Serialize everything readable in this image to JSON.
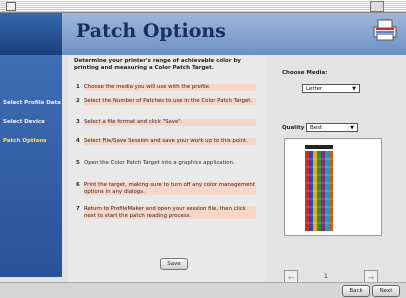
{
  "header": {
    "title": "Patch Options"
  },
  "sidebar": {
    "items": [
      {
        "label": "Select Profile Data"
      },
      {
        "label": "Select Device"
      },
      {
        "label": "Patch Options"
      }
    ]
  },
  "instructions": {
    "intro": "Determine your printer's range of achievable color by printing and measuring a Color Patch Target.",
    "steps": [
      {
        "num": "1",
        "text": "Choose the media you will use with the profile."
      },
      {
        "num": "2",
        "text": "Select the Number of Patches to use in the Color Patch Target."
      },
      {
        "num": "3",
        "text": "Select a file format and click \"Save\"."
      },
      {
        "num": "4",
        "text": "Select File/Save Session and save your work up to this point."
      },
      {
        "num": "5",
        "text": "Open the Color Patch Target into a graphics application."
      },
      {
        "num": "6",
        "text": "Print the target, making sure to turn off any color management options in any dialogs."
      },
      {
        "num": "7",
        "text": "Return to ProfileMaker and open your session file, then click next to start the patch reading process."
      }
    ]
  },
  "buttons": {
    "save": "Save",
    "back": "Back",
    "next": "Next"
  },
  "options": {
    "paper_label": "Choose Media:",
    "paper_value": "Letter",
    "quality_label": "Quality",
    "quality_value": "Best"
  },
  "stepper": {
    "value": "1"
  }
}
